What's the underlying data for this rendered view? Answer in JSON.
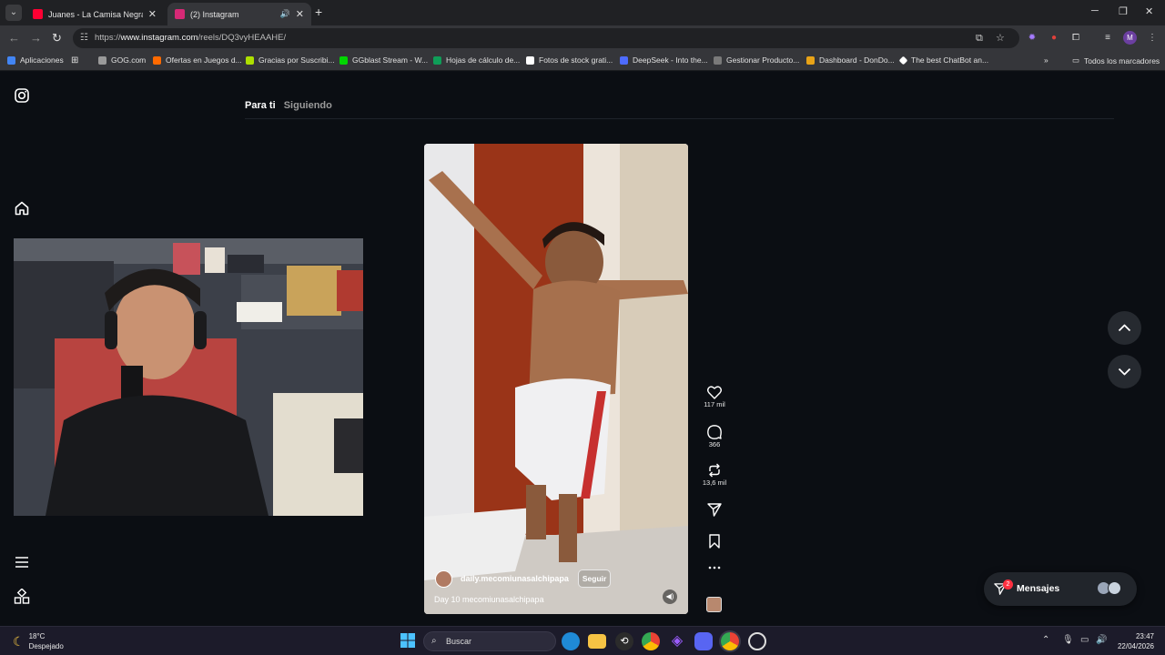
{
  "browser": {
    "tabs": [
      {
        "title": "Juanes - La Camisa Negra - You",
        "favicon_color": "#ff0033"
      },
      {
        "title": "(2) Instagram",
        "favicon_color": "#d62976"
      }
    ],
    "url_prefix": "https://",
    "url_host": "www.instagram.com",
    "url_path": "/reels/DQ3vyHEAAHE/",
    "profile_initial": "M",
    "bookmarks": [
      {
        "label": "Aplicaciones",
        "color": "#4285f4"
      },
      {
        "label": "GOG.com",
        "color": "#9a9a9a"
      },
      {
        "label": "Ofertas en Juegos d...",
        "color": "#ff6a00"
      },
      {
        "label": "Gracias por Suscribi...",
        "color": "#aee000"
      },
      {
        "label": "GGblast Stream - W...",
        "color": "#00d600"
      },
      {
        "label": "Hojas de cálculo de...",
        "color": "#0f9d58"
      },
      {
        "label": "Fotos de stock grati...",
        "color": "#ffffff"
      },
      {
        "label": "DeepSeek - Into the...",
        "color": "#4d6bfe"
      },
      {
        "label": "Gestionar Producto...",
        "color": "#7a7a7a"
      },
      {
        "label": "Dashboard - DonDo...",
        "color": "#e8a317"
      },
      {
        "label": "The best ChatBot an...",
        "color": "#ffffff"
      }
    ],
    "all_bookmarks": "Todos los marcadores"
  },
  "instagram": {
    "feed_tabs": {
      "active": "Para ti",
      "other": "Siguiendo"
    },
    "reel": {
      "username": "daily.mecomiunasalchipapa",
      "follow_label": "Seguir",
      "caption": "Day 10 mecomiunasalchipapa"
    },
    "actions": {
      "likes": "117 mil",
      "comments": "366",
      "reposts": "13,6 mil"
    },
    "messages": {
      "label": "Mensajes",
      "badge": "2"
    }
  },
  "taskbar": {
    "weather_temp": "18°C",
    "weather_desc": "Despejado",
    "search_placeholder": "Buscar",
    "time": "23:47",
    "date": "22/04/2026"
  }
}
